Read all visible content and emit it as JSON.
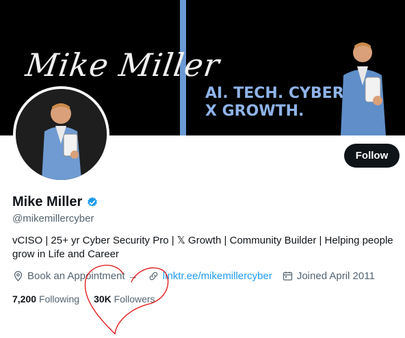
{
  "banner": {
    "name_script": "Mike Miller",
    "tagline_line1": "AI. TECH. CYBER.",
    "tagline_line2": "X GROWTH.",
    "accent": "#6b9ad6"
  },
  "profile": {
    "display_name": "Mike Miller",
    "handle": "@mikemillercyber",
    "verified_icon": "verified-badge-icon",
    "bio_line1": "vCISO | 25+ yr Cyber Security Pro | 𝕏 Growth | Community Builder | Helping people",
    "bio_line2": "grow in Life and Career",
    "follow_label": "Follow"
  },
  "meta": {
    "appointment": "Book an Appointment →",
    "link": "linktr.ee/mikemillercyber",
    "joined": "Joined April 2011"
  },
  "stats": {
    "following_count": "7,200",
    "following_label": "Following",
    "followers_count": "30K",
    "followers_label": "Followers"
  },
  "colors": {
    "accent": "#1d9bf0",
    "annotation": "#e01010"
  }
}
